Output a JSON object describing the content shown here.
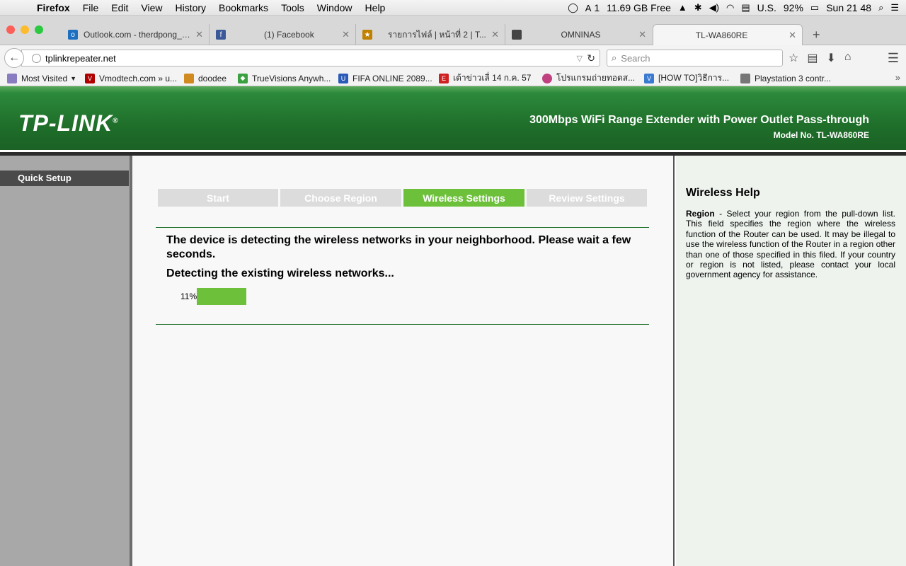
{
  "menubar": {
    "app": "Firefox",
    "menus": [
      "File",
      "Edit",
      "View",
      "History",
      "Bookmarks",
      "Tools",
      "Window",
      "Help"
    ],
    "status": {
      "badge": "1",
      "disk": "11.69 GB Free",
      "input": "U.S.",
      "battery": "92%",
      "clock": "Sun 21 48"
    }
  },
  "tabs": [
    {
      "title": "Outlook.com - therdpong_p...",
      "color": "#1e6fc0"
    },
    {
      "title": "(1) Facebook",
      "color": "#3b5998"
    },
    {
      "title": "รายการไฟล์ | หน้าที่ 2 | T...",
      "color": "#c08000"
    },
    {
      "title": "OMNINAS",
      "color": "#444444"
    },
    {
      "title": "TL-WA860RE",
      "color": ""
    }
  ],
  "nav": {
    "url": "tplinkrepeater.net",
    "search_placeholder": "Search"
  },
  "bookmarks": [
    "Most Visited",
    "Vmodtech.com » u...",
    "doodee",
    "TrueVisions Anywh...",
    "FIFA ONLINE 2089...",
    "เต้าข่าวเลื่ 14 ก.ค. 57",
    "โปรแกรมถ่ายทอดส...",
    "[HOW TO]วิธีการ...",
    "Playstation 3 contr..."
  ],
  "router": {
    "logo": "TP-LINK",
    "product": "300Mbps WiFi Range Extender with Power Outlet Pass-through",
    "model": "Model No. TL-WA860RE",
    "sidebar_item": "Quick Setup",
    "steps": [
      "Start",
      "Choose Region",
      "Wireless Settings",
      "Review Settings"
    ],
    "active_step": "Wireless Settings",
    "message": "The device is detecting the wireless networks in your neighborhood. Please wait a few seconds.",
    "detecting": "Detecting the existing wireless networks...",
    "progress_label": "11%",
    "progress": 0.11,
    "help_title": "Wireless Help",
    "help_term": "Region",
    "help_text": " - Select your region from the pull-down list. This field specifies the region where the wireless function of the Router can be used. It may be illegal to use the wireless function of the Router in a region other than one of those specified in this filed. If your country or region is not listed, please contact your local government agency for assistance."
  },
  "colors": {
    "accent": "#6cc03a",
    "header_green": "#1f6f2a"
  }
}
